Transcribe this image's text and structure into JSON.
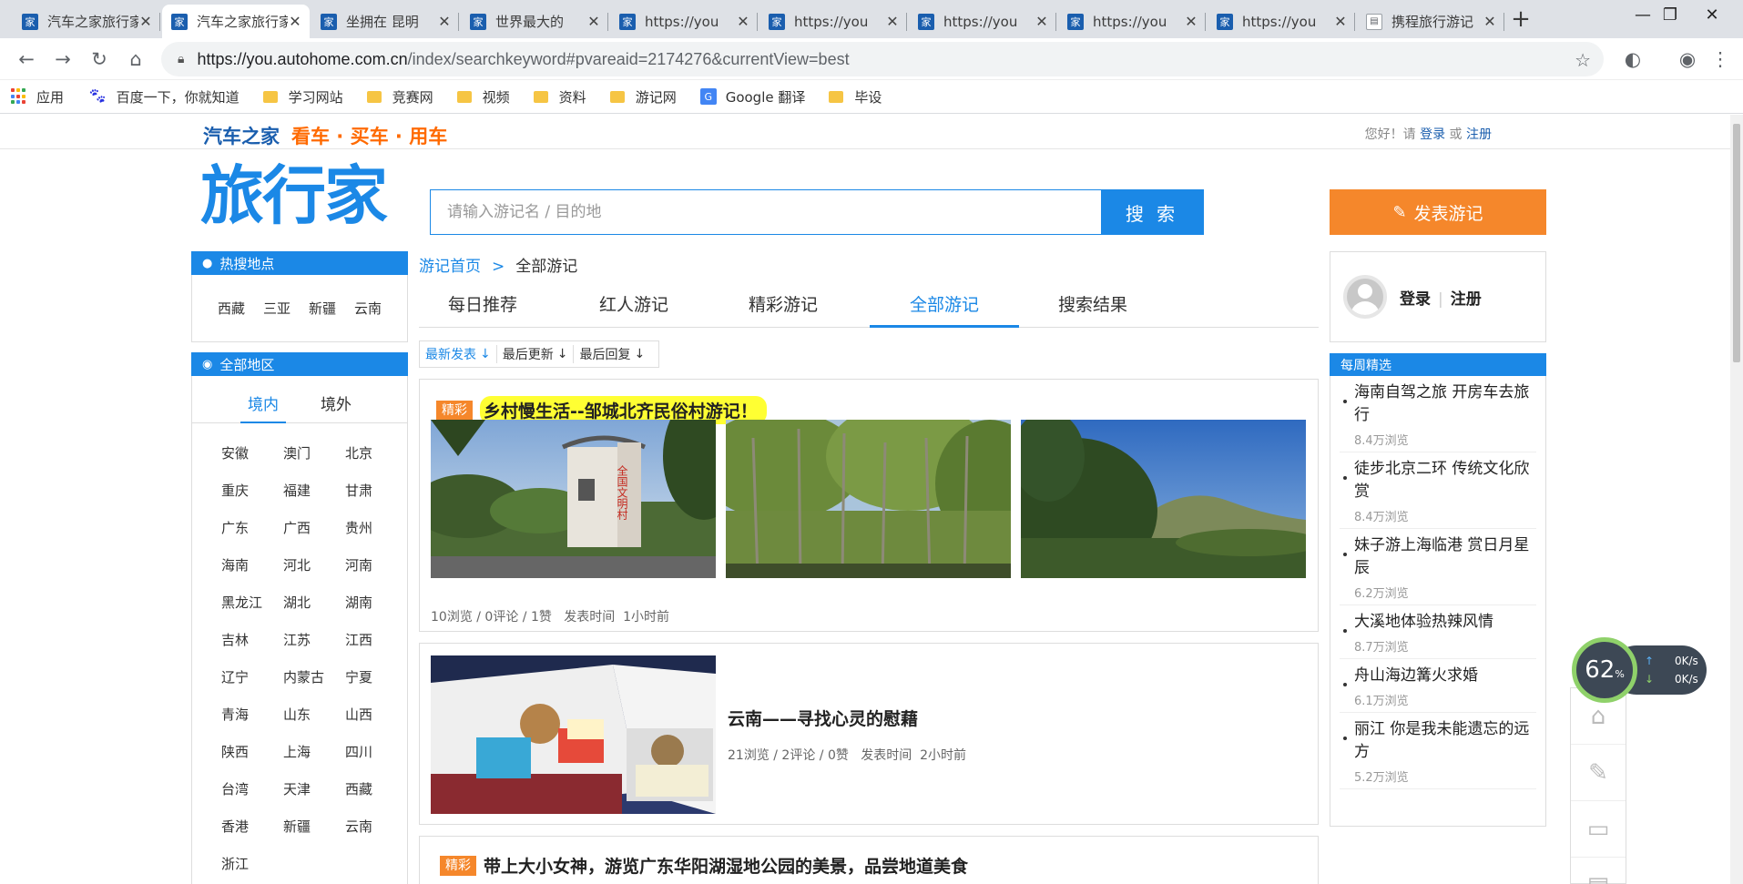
{
  "browser": {
    "tabs": [
      {
        "title": "汽车之家旅行家",
        "icon": "autohome-favicon"
      },
      {
        "title": "汽车之家旅行家",
        "icon": "autohome-favicon",
        "active": true
      },
      {
        "title": "坐拥在 昆明",
        "icon": "autohome-favicon"
      },
      {
        "title": "世界最大的",
        "icon": "autohome-favicon"
      },
      {
        "title": "https://you",
        "icon": "autohome-favicon"
      },
      {
        "title": "https://you",
        "icon": "autohome-favicon"
      },
      {
        "title": "https://you",
        "icon": "autohome-favicon"
      },
      {
        "title": "https://you",
        "icon": "autohome-favicon"
      },
      {
        "title": "https://you",
        "icon": "autohome-favicon"
      },
      {
        "title": "携程旅行游记",
        "icon": "document-icon"
      }
    ],
    "url_host": "https://you.autohome.com.cn",
    "url_path": "/index/searchkeyword#pvareaid=2174276&currentView=best",
    "bookmarks": [
      {
        "label": "应用",
        "icon": "apps-icon"
      },
      {
        "label": "百度一下，你就知道",
        "icon": "baidu-icon"
      },
      {
        "label": "学习网站",
        "icon": "folder-icon"
      },
      {
        "label": "竞赛网",
        "icon": "folder-icon"
      },
      {
        "label": "视频",
        "icon": "folder-icon"
      },
      {
        "label": "资料",
        "icon": "folder-icon"
      },
      {
        "label": "游记网",
        "icon": "folder-icon"
      },
      {
        "label": "Google 翻译",
        "icon": "google-translate-icon"
      },
      {
        "label": "毕设",
        "icon": "folder-icon"
      }
    ]
  },
  "site": {
    "logo": "汽车之家",
    "slogan": "看车 · 买车 · 用车",
    "greeting": "您好！请",
    "login": "登录",
    "or": "或",
    "register": "注册",
    "brand": "旅行家",
    "search_placeholder": "请输入游记名 / 目的地",
    "search_button": "搜 索",
    "post_button": "发表游记"
  },
  "left": {
    "hot_title": "热搜地点",
    "hot_places": [
      "西藏",
      "三亚",
      "新疆",
      "云南"
    ],
    "region_title": "全部地区",
    "region_tabs": [
      "境内",
      "境外"
    ],
    "regions": [
      "安徽",
      "澳门",
      "北京",
      "重庆",
      "福建",
      "甘肃",
      "广东",
      "广西",
      "贵州",
      "海南",
      "河北",
      "河南",
      "黑龙江",
      "湖北",
      "湖南",
      "吉林",
      "江苏",
      "江西",
      "辽宁",
      "内蒙古",
      "宁夏",
      "青海",
      "山东",
      "山西",
      "陕西",
      "上海",
      "四川",
      "台湾",
      "天津",
      "西藏",
      "香港",
      "新疆",
      "云南",
      "浙江"
    ]
  },
  "main": {
    "crumb_home": "游记首页",
    "crumb_sep": ">",
    "crumb_current": "全部游记",
    "tabs": [
      "每日推荐",
      "红人游记",
      "精彩游记",
      "全部游记",
      "搜索结果"
    ],
    "active_tab": "全部游记",
    "sorts": [
      {
        "label": "最新发表",
        "arrow": "↓"
      },
      {
        "label": "最后更新",
        "arrow": "↓"
      },
      {
        "label": "最后回复",
        "arrow": "↓"
      }
    ],
    "posts": [
      {
        "badge": "精彩",
        "title": "乡村慢生活--邹城北齐民俗村游记！",
        "stats": "10浏览 / 0评论 / 1赞",
        "time_label": "发表时间",
        "time": "1小时前"
      },
      {
        "badge": "",
        "title": "云南——寻找心灵的慰藉",
        "stats": "21浏览 / 2评论 / 0赞",
        "time_label": "发表时间",
        "time": "2小时前"
      },
      {
        "badge": "精彩",
        "title": "带上大小女神，游览广东华阳湖湿地公园的美景，品尝地道美食"
      }
    ],
    "sign_text": "全国文明村"
  },
  "right": {
    "login": "登录",
    "register": "注册",
    "weekly_title": "每周精选",
    "weekly": [
      {
        "title": "海南自驾之旅 开房车去旅行",
        "views": "8.4万浏览"
      },
      {
        "title": "徒步北京二环 传统文化欣赏",
        "views": "8.4万浏览"
      },
      {
        "title": "妹子游上海临港 赏日月星辰",
        "views": "6.2万浏览"
      },
      {
        "title": "大溪地体验热辣风情",
        "views": "8.7万浏览"
      },
      {
        "title": "舟山海边篝火求婚",
        "views": "6.1万浏览"
      },
      {
        "title": "丽江 你是我未能遗忘的远方",
        "views": "5.2万浏览"
      }
    ]
  },
  "widget": {
    "percent": "62",
    "percent_unit": "%",
    "up": "0K/s",
    "down": "0K/s"
  }
}
